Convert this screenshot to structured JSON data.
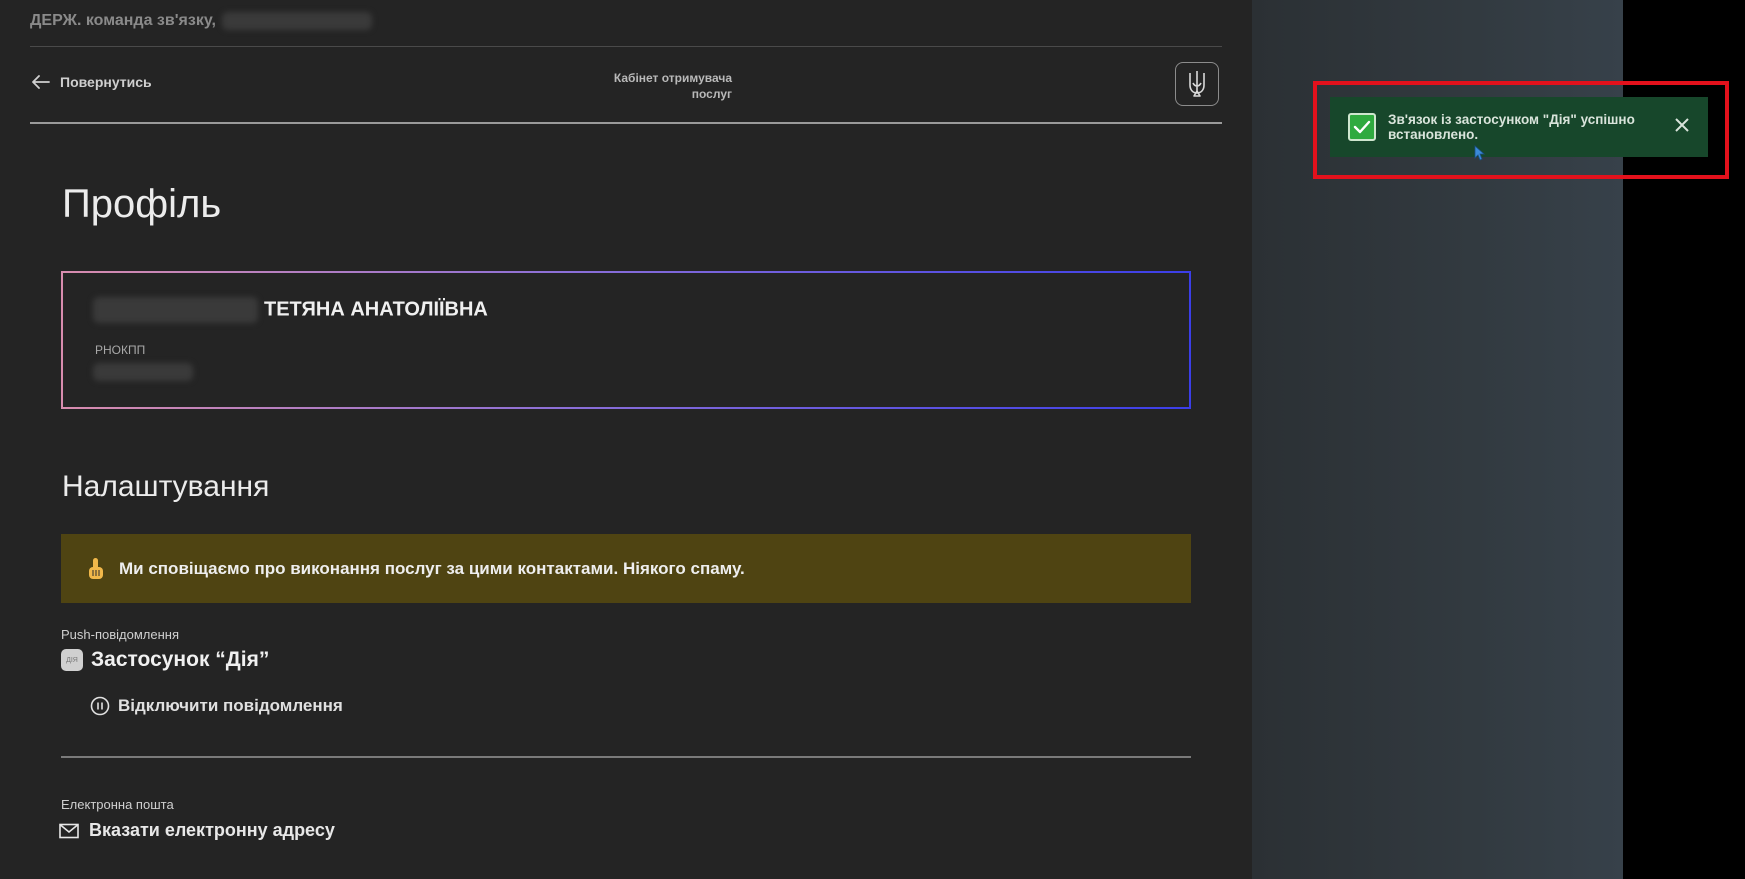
{
  "header": {
    "org_title": "ДЕРЖ. команда зв'язку,",
    "back_label": "Повернутись",
    "cabinet_line1": "Кабінет отримувача",
    "cabinet_line2": "послуг",
    "emblem_icon": "trident-icon"
  },
  "profile": {
    "page_title": "Профіль",
    "name_visible": "ТЕТЯНА АНАТОЛІЇВНА",
    "rnokpp_label": "РНОКПП"
  },
  "settings": {
    "section_title": "Налаштування",
    "notice_text": "Ми сповіщаємо про виконання послуг за цими контактами. Ніякого спаму.",
    "push_label": "Push-повідомлення",
    "app_name": "Застосунок “Дія”",
    "app_icon_text": "ДІЯ",
    "disable_label": "Відключити повідомлення",
    "email_label": "Електронна пошта",
    "email_action": "Вказати електронну адресу"
  },
  "toast": {
    "message": "Зв'язок із застосунком \"Дія\" успішно встановлено.",
    "status_color": "#2faa3f",
    "highlight_color": "#e3111c"
  },
  "colors": {
    "background": "#242424",
    "notice_bg": "#4f4412",
    "toast_bg": "#17472b"
  }
}
